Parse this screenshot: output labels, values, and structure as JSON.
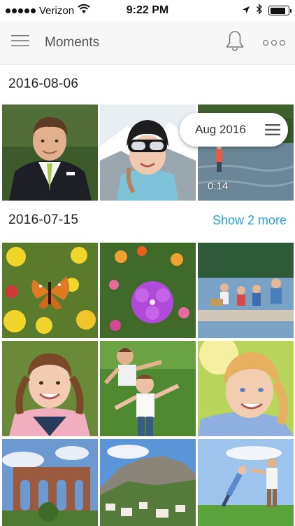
{
  "status_bar": {
    "carrier": "Verizon",
    "time": "9:22 PM",
    "battery_level": 0.85
  },
  "header": {
    "title": "Moments",
    "menu_icon": "hamburger-menu-icon",
    "notifications_icon": "bell-icon",
    "more_icon": "more-dots-icon"
  },
  "sections": [
    {
      "date": "2016-08-06",
      "items": [
        {
          "kind": "photo",
          "subject": "boy-in-suit"
        },
        {
          "kind": "photo",
          "subject": "girl-ski-goggles"
        },
        {
          "kind": "video",
          "subject": "person-fishing-river",
          "duration": "0:14"
        }
      ]
    },
    {
      "date": "2016-07-15",
      "show_more": "Show 2 more",
      "items": [
        {
          "kind": "photo",
          "subject": "butterfly-flowers"
        },
        {
          "kind": "photo",
          "subject": "purple-flowers"
        },
        {
          "kind": "photo",
          "subject": "family-on-dock"
        },
        {
          "kind": "photo",
          "subject": "girl-pigtails"
        },
        {
          "kind": "photo",
          "subject": "kids-in-grass"
        },
        {
          "kind": "photo",
          "subject": "smiling-girl-sunlight"
        },
        {
          "kind": "photo",
          "subject": "aqueduct-ruins"
        },
        {
          "kind": "photo",
          "subject": "coastal-cliffs"
        },
        {
          "kind": "photo",
          "subject": "father-lifting-child"
        }
      ]
    }
  ],
  "scroller": {
    "label": "Aug 2016",
    "icon": "drag-handle-icon"
  },
  "colors": {
    "accent": "#2a9fd8",
    "header_bg": "#f7f7f7"
  }
}
